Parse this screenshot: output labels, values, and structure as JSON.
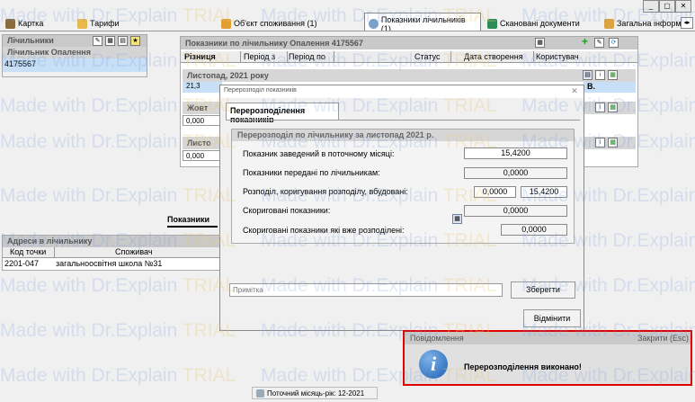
{
  "tabs": [
    {
      "label": "Картка",
      "icon": "card-icon"
    },
    {
      "label": "Тарифи",
      "icon": "tariff-icon"
    },
    {
      "label": "Об'єкт споживання (1)",
      "icon": "object-icon"
    },
    {
      "label": "Показники лічильників (1)",
      "icon": "meter-readings-icon"
    },
    {
      "label": "Скановані документи",
      "icon": "scan-icon"
    },
    {
      "label": "Загальна інформ",
      "icon": "info-icon"
    }
  ],
  "meters": {
    "title": "Лічильники",
    "header": "Лічильник Опалення",
    "value": "4175567"
  },
  "readings": {
    "title": "Показники по лічильнику Опалення 4175567",
    "columns": [
      "Різниця",
      "Період з",
      "Період по",
      "Статус",
      "Дата створення",
      "Користувач"
    ],
    "groups": [
      {
        "title": "Листопад, 2021 року",
        "value": "21,3",
        "suffix": "В."
      },
      {
        "title": "Жовт",
        "value": "0,000"
      },
      {
        "title": "Листо",
        "value": "0,000"
      }
    ]
  },
  "middle_tab": "Показники",
  "addresses": {
    "title": "Адреси в лічильнику",
    "columns": [
      "Код точки",
      "Споживач"
    ],
    "rows": [
      {
        "code": "2201-047",
        "consumer": "загальноосвітня школа №31"
      }
    ]
  },
  "dialog": {
    "window_title": "Перерозподіл показників",
    "tab": "Перерозподілення показників",
    "group_title": "Перерозподіл по лічильнику за листопад 2021 р.",
    "rows": [
      {
        "label": "Показник заведений в поточному місяці:",
        "value": "15,4200"
      },
      {
        "label": "Показники передані по лічильникам:",
        "value": "0,0000"
      },
      {
        "label": "Розподіл, коригування розподілу, вбудовані:",
        "value": "0,0000",
        "value2": "15,4200"
      },
      {
        "label": "Скориговані показники:",
        "value": "0,0000"
      },
      {
        "label": "Скориговані показники які вже розподілені:",
        "value": "0,0000"
      }
    ],
    "note_placeholder": "Примітка",
    "save_label": "Зберегти",
    "cancel_label": "Відмінити"
  },
  "status_bar": {
    "text": "Поточний місяць-рік: 12-2021"
  },
  "notification": {
    "title": "Повідомлення",
    "close_label": "Закрити (Esc)",
    "message": "Перерозподілення виконано!"
  },
  "watermark": {
    "prefix": "Made with Dr.Explain",
    "trial": "TRIAL"
  },
  "colors": {
    "accent_border": "#e00000",
    "selection": "#c7e0f7",
    "watermark_blue": "#7896dc",
    "watermark_orange": "#ebc878"
  }
}
